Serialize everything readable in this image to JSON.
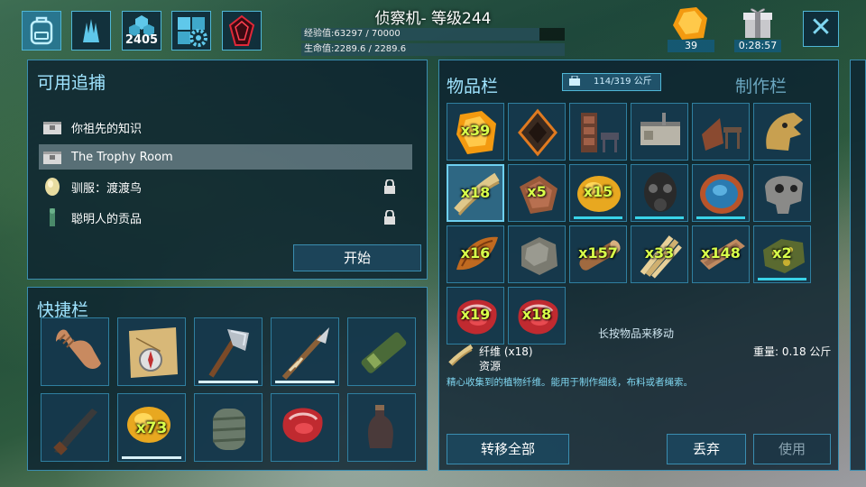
{
  "header": {
    "title": "侦察机- 等级244",
    "xp": "经验值:63297 / 70000",
    "xp_fraction": 0.904,
    "hp": "生命值:2289.6 / 2289.6",
    "hp_fraction": 1.0,
    "engram_points": "2405",
    "element_count": "39",
    "timer": "0:28:57"
  },
  "tracking": {
    "title": "可用追捕",
    "items": [
      {
        "label": "你祖先的知识",
        "icon": "crate-icon"
      },
      {
        "label": "The Trophy Room",
        "icon": "crate-icon",
        "selected": true
      },
      {
        "label": "驯服：渡渡鸟",
        "icon": "egg-icon",
        "locked": true
      },
      {
        "label": "聪明人的贡品",
        "icon": "figure-icon",
        "locked": true
      }
    ],
    "start_label": "开始"
  },
  "hotbar": {
    "title": "快捷栏",
    "slots": [
      {
        "icon": "hand-icon"
      },
      {
        "icon": "map-compass-icon"
      },
      {
        "icon": "hatchet-icon",
        "durability": 1.0
      },
      {
        "icon": "spear-icon",
        "durability": 1.0
      },
      {
        "icon": "spyglass-icon"
      },
      {
        "icon": "shotgun-icon"
      },
      {
        "icon": "lemon-icon",
        "qty": "x73",
        "durability": 1.0
      },
      {
        "icon": "bandage-icon"
      },
      {
        "icon": "raw-meat-icon"
      },
      {
        "icon": "bottle-icon"
      }
    ]
  },
  "inventory": {
    "title": "物品栏",
    "weight_badge": "114/319 公斤",
    "craft_tab": "制作栏",
    "hint": "长按物品来移动",
    "slots": [
      {
        "icon": "element-icon",
        "qty": "x39"
      },
      {
        "icon": "artifact-icon"
      },
      {
        "icon": "bookshelf-icon"
      },
      {
        "icon": "kitchen-icon"
      },
      {
        "icon": "furniture-icon"
      },
      {
        "icon": "trophy-head-icon"
      },
      {
        "icon": "fiber-icon",
        "qty": "x18",
        "selected": true
      },
      {
        "icon": "hide-icon",
        "qty": "x5"
      },
      {
        "icon": "lemon-icon",
        "qty": "x15",
        "durability": 1.0
      },
      {
        "icon": "gas-mask-icon",
        "durability": 1.0
      },
      {
        "icon": "bowl-icon",
        "durability": 1.0
      },
      {
        "icon": "skull-icon"
      },
      {
        "icon": "chitin-icon",
        "qty": "x16"
      },
      {
        "icon": "stone-icon"
      },
      {
        "icon": "wood-icon",
        "qty": "x157"
      },
      {
        "icon": "thatch-icon",
        "qty": "x33"
      },
      {
        "icon": "wood-plank-icon",
        "qty": "x148"
      },
      {
        "icon": "ore-icon",
        "qty": "x2",
        "durability": 1.0
      },
      {
        "icon": "raw-meat-icon",
        "qty": "x19"
      },
      {
        "icon": "raw-meat-icon",
        "qty": "x18"
      }
    ],
    "selected_item": {
      "name": "纤维 (x18)",
      "category": "资源",
      "weight": "重量: 0.18 公斤",
      "description": "精心收集到的植物纤维。能用于制作细线，布料或者绳索。"
    },
    "transfer_all": "转移全部",
    "drop": "丢弃",
    "use": "使用"
  },
  "colors": {
    "accent": "#3a8db0",
    "panel_bg": "#0c2230",
    "qty_text": "#d8ff4a",
    "durability": "#39d3e8"
  }
}
